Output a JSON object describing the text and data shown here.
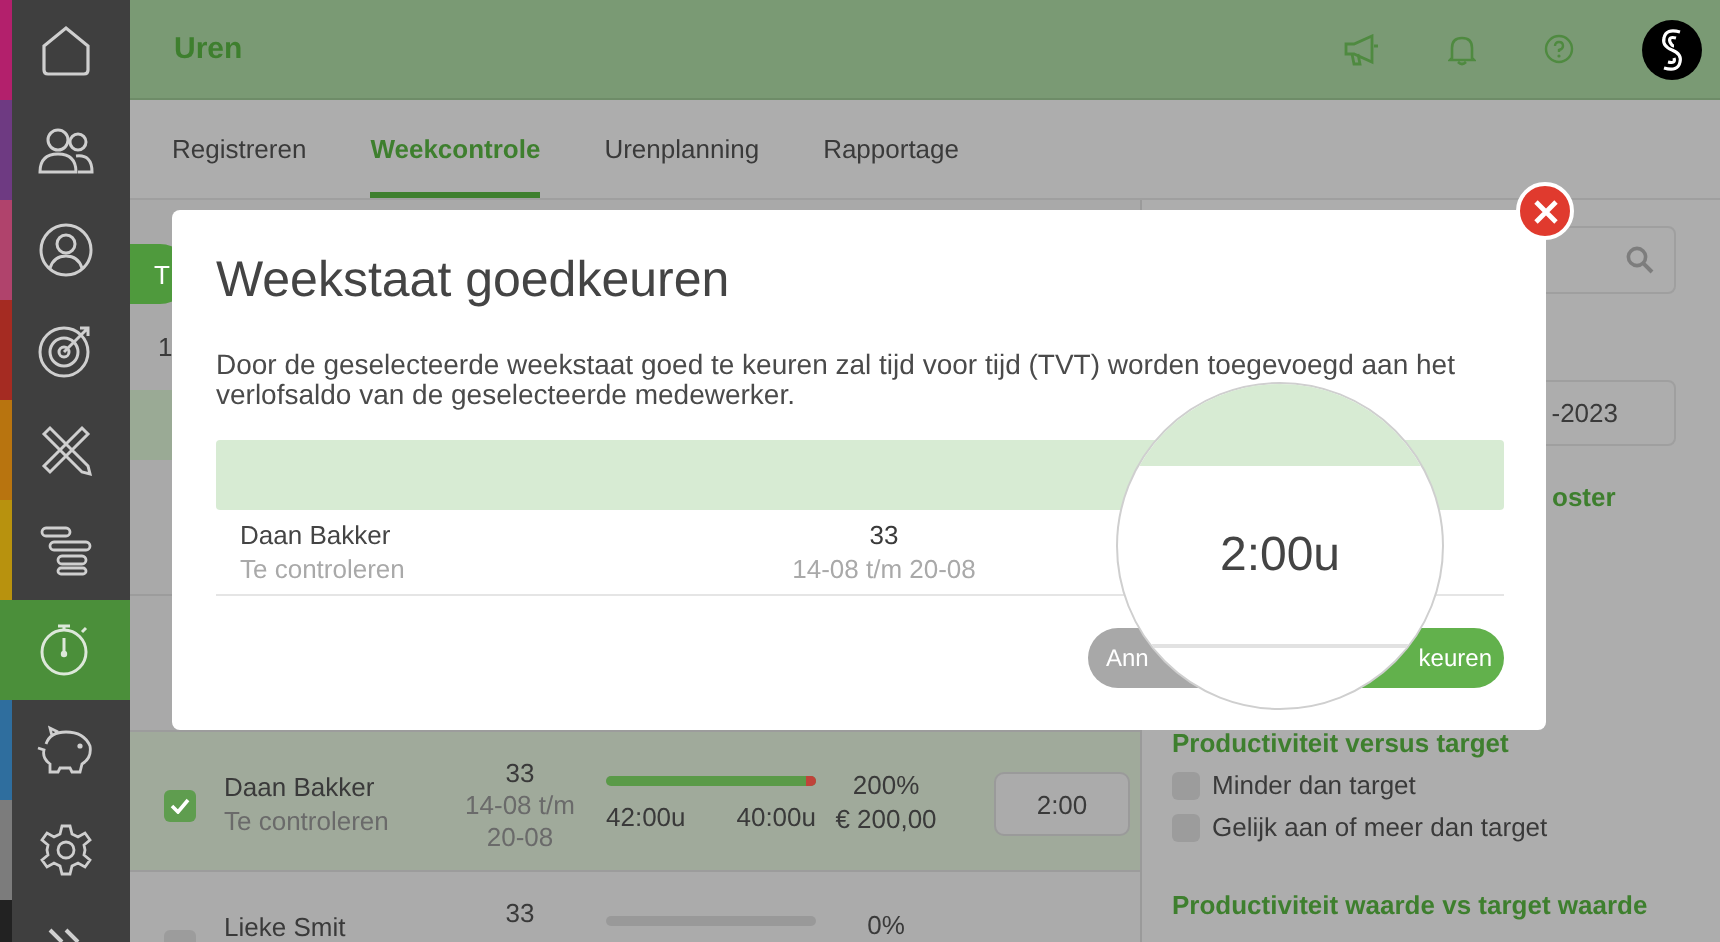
{
  "sidebar": {
    "items": [
      {
        "color": "#b3206c",
        "selected": false
      },
      {
        "color": "#6e3a82",
        "selected": false
      },
      {
        "color": "#b0436c",
        "selected": false
      },
      {
        "color": "#a52b22",
        "selected": false
      },
      {
        "color": "#b8740f",
        "selected": false
      },
      {
        "color": "#b8920e",
        "selected": false
      },
      {
        "color": "#4b8f3a",
        "selected": true
      },
      {
        "color": "#2f6e9e",
        "selected": false
      },
      {
        "color": "#7c7c7c",
        "selected": false
      },
      {
        "color": "#222222",
        "selected": false
      }
    ]
  },
  "header": {
    "title": "Uren"
  },
  "tabs": [
    {
      "label": "Registreren",
      "selected": false
    },
    {
      "label": "Weekcontrole",
      "selected": true
    },
    {
      "label": "Urenplanning",
      "selected": false
    },
    {
      "label": "Rapportage",
      "selected": false
    }
  ],
  "list": {
    "pill_button": "T",
    "count": "1",
    "rows": [
      {
        "name": "Daan Bakker",
        "status": "Te controleren",
        "week": "33",
        "period": "14-08 t/m 20-08",
        "checked": true,
        "selected": true,
        "level": 1,
        "over": true,
        "hours": "42:00u",
        "target": "40:00u",
        "percent": "200%",
        "amount": "€ 200,00",
        "tvt": "2:00"
      },
      {
        "name": "Lieke Smit",
        "week": "33",
        "checked": false,
        "selected": false,
        "level": 0,
        "over": false,
        "percent": "0%"
      }
    ]
  },
  "filters": {
    "date_value": "-2023",
    "heading": "oster",
    "productivity": {
      "title": "Productiviteit versus target",
      "options": [
        {
          "label": "Minder dan target",
          "checked": false
        },
        {
          "label": "Gelijk aan of meer dan target",
          "checked": false
        }
      ]
    },
    "value_heading": "Productiviteit waarde vs target waarde"
  },
  "modal": {
    "title": "Weekstaat goedkeuren",
    "description": "Door de geselecteerde weekstaat goed te keuren zal tijd voor tijd (TVT) worden toegevoegd aan het verlofsaldo van de geselecteerde medewerker.",
    "row": {
      "name": "Daan Bakker",
      "status": "Te controleren",
      "week": "33",
      "period": "14-08 t/m 20-08"
    },
    "magnifier_text": "2:00u",
    "buttons": [
      {
        "label": "Ann",
        "kind": "secondary"
      },
      {
        "label": "keuren",
        "kind": "primary"
      }
    ]
  }
}
